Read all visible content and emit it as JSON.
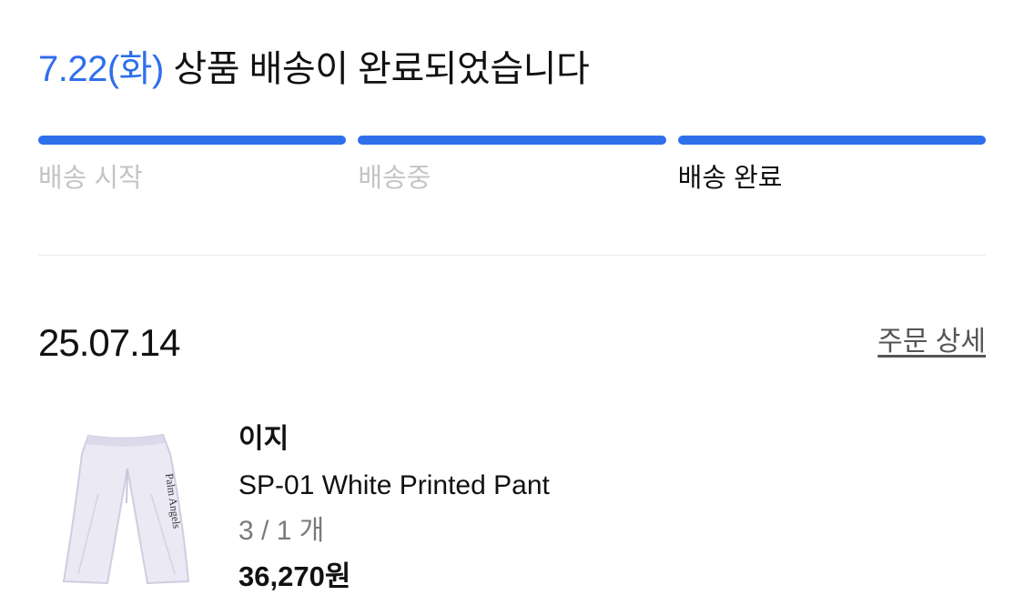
{
  "header": {
    "date_label": "7.22(화)",
    "status_text": "상품 배송이 완료되었습니다"
  },
  "progress": {
    "steps": [
      {
        "label": "배송 시작",
        "completed": true,
        "current": false
      },
      {
        "label": "배송중",
        "completed": true,
        "current": false
      },
      {
        "label": "배송 완료",
        "completed": true,
        "current": true
      }
    ],
    "colors": {
      "bar": "#2f6fec",
      "inactive_label": "#c4c4c4",
      "active_label": "#111111"
    }
  },
  "order": {
    "date": "25.07.14",
    "detail_link": "주문 상세"
  },
  "product": {
    "image_icon": "white-pants-image",
    "image_text": "Palm Angels",
    "brand": "이지",
    "name": "SP-01 White Printed Pant",
    "options": "3 / 1 개",
    "price": "36,270원"
  }
}
